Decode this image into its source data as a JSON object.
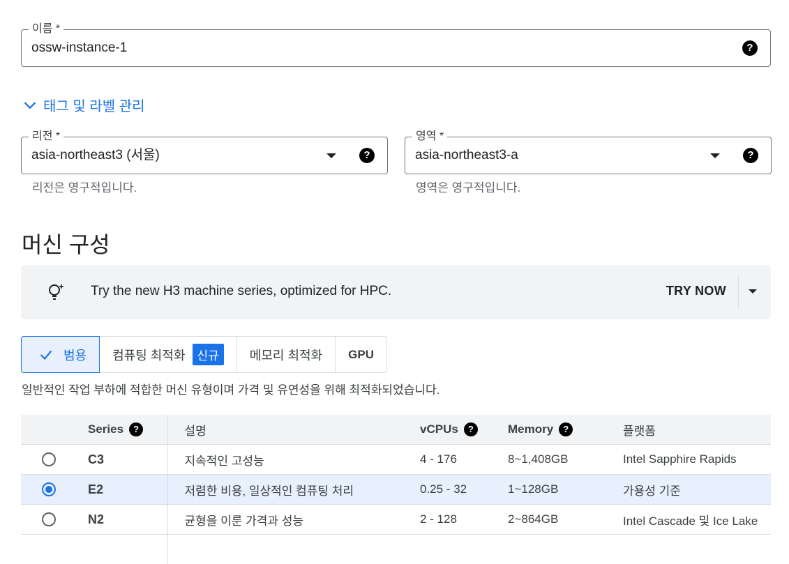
{
  "name_field": {
    "label": "이름 *",
    "value": "ossw-instance-1"
  },
  "tags_link": {
    "label": "태그 및 라벨 관리"
  },
  "region_field": {
    "label": "리전 *",
    "value": "asia-northeast3 (서울)",
    "hint": "리전은 영구적입니다."
  },
  "zone_field": {
    "label": "영역 *",
    "value": "asia-northeast3-a",
    "hint": "영역은 영구적입니다."
  },
  "section_title": "머신 구성",
  "banner": {
    "text": "Try the new H3 machine series, optimized for HPC.",
    "action": "TRY NOW"
  },
  "tabs": [
    {
      "label": "범용",
      "active": true
    },
    {
      "label": "컴퓨팅 최적화",
      "badge": "신규"
    },
    {
      "label": "메모리 최적화"
    },
    {
      "label": "GPU"
    }
  ],
  "tab_description": "일반적인 작업 부하에 적합한 머신 유형이며 가격 및 유연성을 위해 최적화되었습니다.",
  "table": {
    "headers": {
      "series": "Series",
      "description": "설명",
      "vcpus": "vCPUs",
      "memory": "Memory",
      "platform": "플랫폼"
    },
    "rows": [
      {
        "series": "C3",
        "description": "지속적인 고성능",
        "vcpus": "4 - 176",
        "memory": "8~1,408GB",
        "platform": "Intel Sapphire Rapids",
        "selected": false
      },
      {
        "series": "E2",
        "description": "저렴한 비용, 일상적인 컴퓨팅 처리",
        "vcpus": "0.25 - 32",
        "memory": "1~128GB",
        "platform": "가용성 기준",
        "selected": true
      },
      {
        "series": "N2",
        "description": "균형을 이룬 가격과 성능",
        "vcpus": "2 - 128",
        "memory": "2~864GB",
        "platform": "Intel Cascade 및 Ice Lake",
        "selected": false
      }
    ]
  },
  "colors": {
    "accent": "#1a73e8",
    "selected_row": "#e8f0fe",
    "banner_bg": "#f1f3f4"
  },
  "icons": {
    "help": "help-circle-icon",
    "dropdown": "triangle-down-icon",
    "bulb": "lightbulb-sparkle-icon",
    "check": "check-icon",
    "chevron": "chevron-down-icon",
    "radio": "radio-icon"
  }
}
